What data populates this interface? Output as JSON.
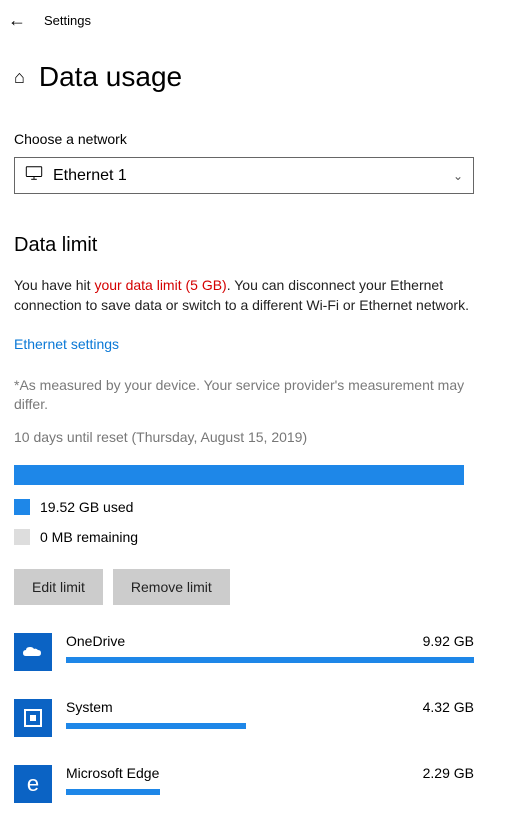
{
  "header": {
    "settings_label": "Settings"
  },
  "page": {
    "title": "Data usage",
    "choose_label": "Choose a network",
    "selected_network": "Ethernet 1"
  },
  "data_limit": {
    "heading": "Data limit",
    "msg_prefix": "You have hit ",
    "msg_red": "your data limit (5 GB)",
    "msg_suffix": ".  You can disconnect your Ethernet connection to save data or switch to a different Wi-Fi or Ethernet network.",
    "eth_link": "Ethernet settings",
    "disclaimer": "*As measured by your device. Your service provider's measurement may differ.",
    "reset": "10 days until reset (Thursday, August 15, 2019)",
    "used_legend": "19.52 GB used",
    "remaining_legend": "0 MB remaining",
    "edit_btn": "Edit limit",
    "remove_btn": "Remove limit"
  },
  "apps": [
    {
      "name": "OneDrive",
      "amount": "9.92 GB",
      "bar_pct": 100
    },
    {
      "name": "System",
      "amount": "4.32 GB",
      "bar_pct": 44
    },
    {
      "name": "Microsoft Edge",
      "amount": "2.29 GB",
      "bar_pct": 23
    }
  ]
}
